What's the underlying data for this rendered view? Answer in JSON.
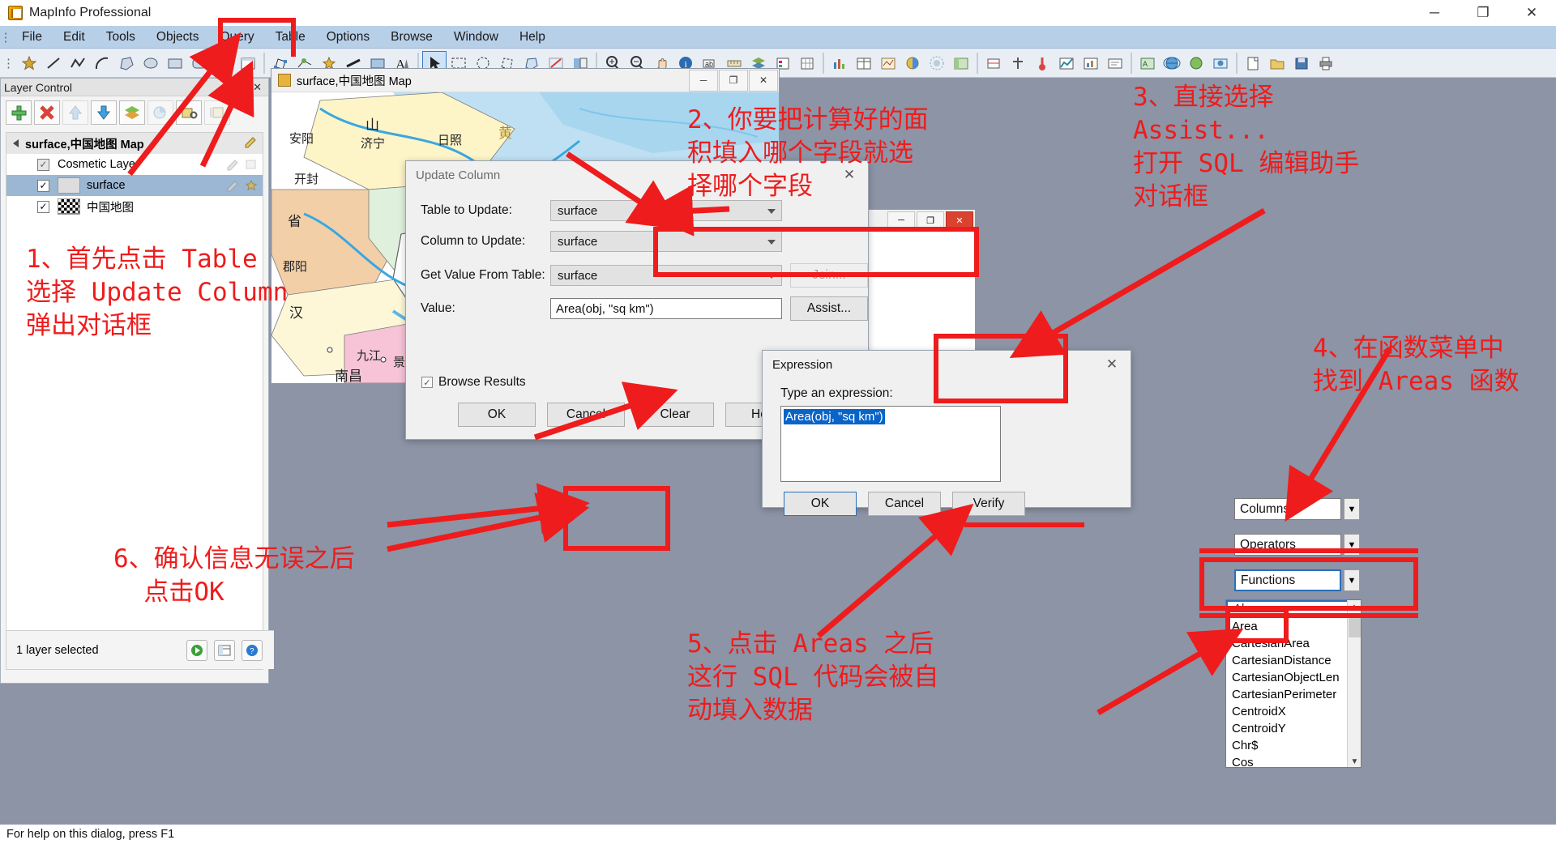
{
  "titlebar": {
    "app_title": "MapInfo Professional",
    "icon": "mapinfo-logo-icon",
    "minimize": "─",
    "maximize": "❐",
    "close": "✕"
  },
  "menubar": {
    "items": [
      "File",
      "Edit",
      "Tools",
      "Objects",
      "Query",
      "Table",
      "Options",
      "Browse",
      "Window",
      "Help"
    ]
  },
  "layer_control": {
    "title": "Layer Control",
    "pin": "┅",
    "close": "✕",
    "toolbar_buttons": [
      "add-layer-button",
      "remove-layer-button",
      "move-up-button",
      "move-down-button",
      "layer-properties-button",
      "thematic-button",
      "hotlink-button",
      "label-button"
    ],
    "tree": {
      "root_label": "surface,中国地图 Map",
      "rows": [
        {
          "label": "Cosmetic Layer",
          "checked": true,
          "swatch": "none",
          "selected": false
        },
        {
          "label": "surface",
          "checked": true,
          "swatch": "plain",
          "selected": true
        },
        {
          "label": "中国地图",
          "checked": true,
          "swatch": "checker",
          "selected": false
        }
      ]
    },
    "status_text": "1 layer selected",
    "status_buttons": [
      "refresh-button",
      "layers-button",
      "help-button"
    ]
  },
  "map_window": {
    "title": "surface,中国地图 Map",
    "minimize": "─",
    "maximize": "❐",
    "close": "✕",
    "map_labels": [
      "山",
      "安阳",
      "济宁",
      "日照",
      "黄",
      "开封",
      "省",
      "郡阳",
      "汉",
      "九江",
      "景德镇",
      "南昌"
    ]
  },
  "browser_window": {
    "minimize": "─",
    "maximize": "❐",
    "close": "✕"
  },
  "update_column_dialog": {
    "title": "Update Column",
    "close": "✕",
    "fields": [
      {
        "label": "Table to Update:",
        "value": "surface",
        "type": "combo"
      },
      {
        "label": "Column to Update:",
        "value": "surface",
        "type": "combo"
      },
      {
        "label": "Get Value From Table:",
        "value": "surface",
        "type": "combo"
      }
    ],
    "value_label": "Value:",
    "value_text": "Area(obj, \"sq km\")",
    "join_button": "Join...",
    "assist_button": "Assist...",
    "browse_results_label": "Browse Results",
    "browse_results_checked": true,
    "buttons": [
      "OK",
      "Cancel",
      "Clear",
      "Help"
    ]
  },
  "expression_dialog": {
    "title": "Expression",
    "close": "✕",
    "prompt": "Type an expression:",
    "expression_value": "Area(obj, \"sq km\")",
    "buttons": [
      "OK",
      "Cancel",
      "Verify"
    ],
    "selectors": [
      {
        "label": "Columns",
        "focused": false
      },
      {
        "label": "Operators",
        "focused": false
      },
      {
        "label": "Functions",
        "focused": true
      }
    ],
    "function_list": {
      "selected": "Abs",
      "items": [
        "Abs",
        "Area",
        "CartesianArea",
        "CartesianDistance",
        "CartesianObjectLen",
        "CartesianPerimeter",
        "CentroidX",
        "CentroidY",
        "Chr$",
        "Cos"
      ]
    }
  },
  "statusbar": {
    "text": "For help on this dialog, press F1"
  },
  "annotations": {
    "color": "#ee1c1c",
    "notes": [
      {
        "id": "note-1",
        "text": "1、首先点击 Table\n选择 Update Column\n弹出对话框"
      },
      {
        "id": "note-2",
        "text": "2、你要把计算好的面\n积填入哪个字段就选\n择哪个字段"
      },
      {
        "id": "note-3",
        "text": "3、直接选择\nAssist...\n打开 SQL 编辑助手\n对话框"
      },
      {
        "id": "note-4",
        "text": "4、在函数菜单中\n找到 Areas 函数"
      },
      {
        "id": "note-5",
        "text": "5、点击 Areas 之后\n这行 SQL 代码会被自\n动填入数据"
      },
      {
        "id": "note-6",
        "text": "6、确认信息无误之后\n  点击OK"
      }
    ]
  }
}
